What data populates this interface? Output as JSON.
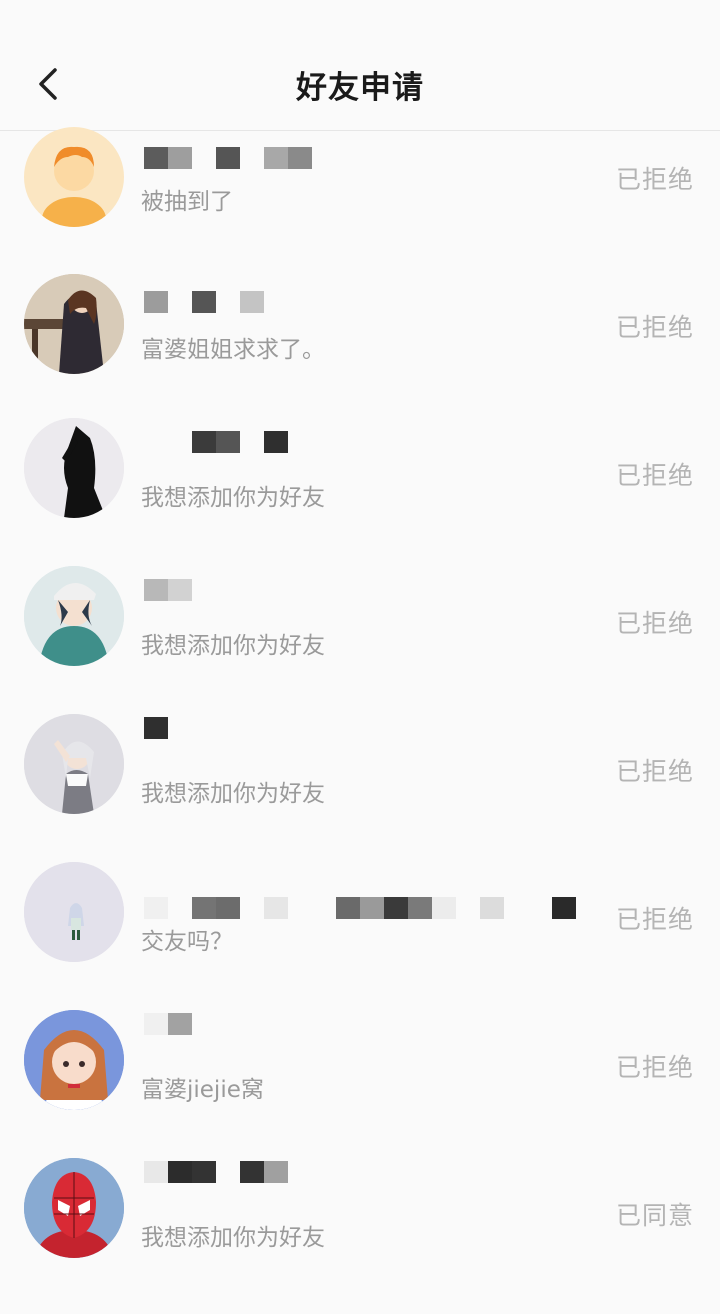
{
  "header": {
    "title": "好友申请"
  },
  "requests": [
    {
      "message": "被抽到了",
      "status": "已拒绝"
    },
    {
      "message": "富婆姐姐求求了。",
      "status": "已拒绝"
    },
    {
      "message": "我想添加你为好友",
      "status": "已拒绝"
    },
    {
      "message": "我想添加你为好友",
      "status": "已拒绝"
    },
    {
      "message": "我想添加你为好友",
      "status": "已拒绝"
    },
    {
      "message": "交友吗？",
      "status": "已拒绝"
    },
    {
      "message": "富婆jiejie窝",
      "status": "已拒绝"
    },
    {
      "message": "我想添加你为好友",
      "status": "已同意"
    }
  ]
}
